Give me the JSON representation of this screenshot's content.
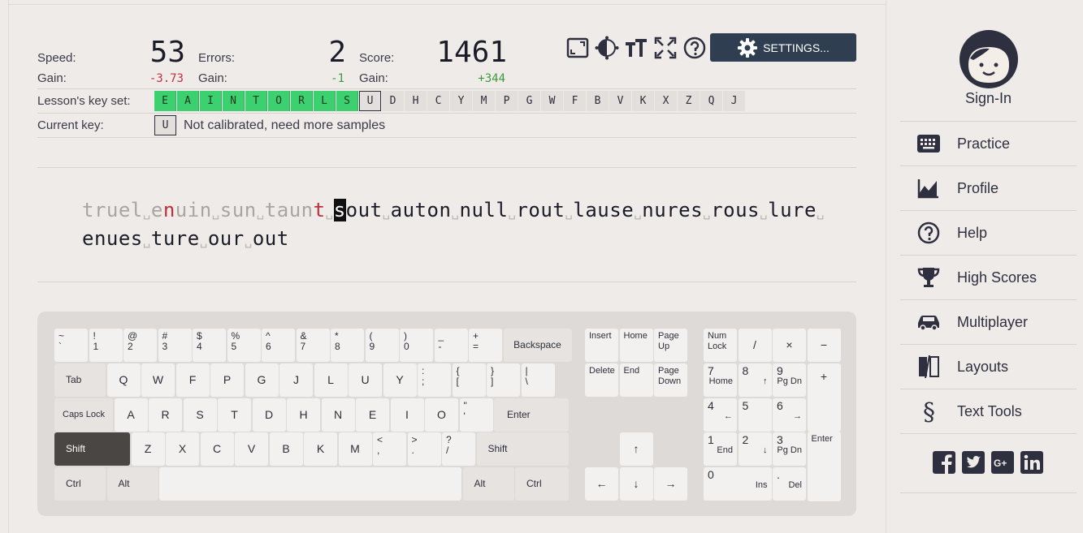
{
  "stats": {
    "speed_label": "Speed:",
    "speed_value": "53",
    "speed_gain_label": "Gain:",
    "speed_gain": "-3.73",
    "errors_label": "Errors:",
    "errors_value": "2",
    "errors_gain_label": "Gain:",
    "errors_gain": "-1",
    "score_label": "Score:",
    "score_value": "1461",
    "score_gain_label": "Gain:",
    "score_gain": "+344"
  },
  "toolbar": {
    "settings_label": "SETTINGS...",
    "icons": [
      "window-size-icon",
      "theme-icon",
      "font-size-icon",
      "fullscreen-icon",
      "help-icon"
    ]
  },
  "lesson": {
    "keyset_label": "Lesson's key set:",
    "keys_done": [
      "E",
      "A",
      "I",
      "N",
      "T",
      "O",
      "R",
      "L",
      "S"
    ],
    "key_current": "U",
    "keys_todo": [
      "D",
      "H",
      "C",
      "Y",
      "M",
      "P",
      "G",
      "W",
      "F",
      "B",
      "V",
      "K",
      "X",
      "Z",
      "Q",
      "J"
    ],
    "current_key_label": "Current key:",
    "current_key": "U",
    "current_key_status": "Not calibrated, need more samples"
  },
  "text": {
    "typed_1": "truel",
    "typed_2": "e",
    "typed_err1": "n",
    "typed_3": "uin",
    "typed_4": "sun",
    "typed_5": "taun",
    "typed_err2": "t",
    "cursor_char": "s",
    "rest_1": "out",
    "line1_words": [
      "auton",
      "null",
      "rout",
      "lause",
      "nures",
      "rous",
      "lure"
    ],
    "line2_words": [
      "enues",
      "ture",
      "our",
      "out"
    ]
  },
  "keyboard": {
    "row1": [
      [
        "~",
        "`"
      ],
      [
        "!",
        "1"
      ],
      [
        "@",
        "2"
      ],
      [
        "#",
        "3"
      ],
      [
        "$",
        "4"
      ],
      [
        "%",
        "5"
      ],
      [
        "^",
        "6"
      ],
      [
        "&",
        "7"
      ],
      [
        "*",
        "8"
      ],
      [
        "(",
        "9"
      ],
      [
        ")",
        "0"
      ],
      [
        "_",
        "-"
      ],
      [
        "+",
        "="
      ]
    ],
    "backspace": "Backspace",
    "tab": "Tab",
    "row2": [
      "Q",
      "W",
      "F",
      "P",
      "G",
      "J",
      "L",
      "U",
      "Y"
    ],
    "row2_sym": [
      [
        ":",
        ";"
      ],
      [
        "{",
        "["
      ],
      [
        "}",
        "]"
      ],
      [
        "|",
        "\\"
      ]
    ],
    "caps": "Caps Lock",
    "row3": [
      "A",
      "R",
      "S",
      "T",
      "D",
      "H",
      "N",
      "E",
      "I",
      "O"
    ],
    "row3_sym": [
      [
        "\"",
        "'"
      ]
    ],
    "enter": "Enter",
    "shift": "Shift",
    "row4": [
      "Z",
      "X",
      "C",
      "V",
      "B",
      "K",
      "M"
    ],
    "row4_sym": [
      [
        "<",
        ","
      ],
      [
        ">",
        "."
      ],
      [
        "?",
        "/"
      ]
    ],
    "ctrl": "Ctrl",
    "alt": "Alt",
    "nav_keys": [
      "Insert",
      "Home",
      "Page Up",
      "Delete",
      "End",
      "Page Down"
    ],
    "arrows": [
      "↑",
      "←",
      "↓",
      "→"
    ],
    "numpad": {
      "numlock": "Num Lock",
      "div": "/",
      "mul": "×",
      "minus": "−",
      "plus": "+",
      "enter": "Enter",
      "n7": [
        "7",
        "Home"
      ],
      "n8": [
        "8",
        "↑"
      ],
      "n9": [
        "9",
        "Pg Dn"
      ],
      "n4": [
        "4",
        "←"
      ],
      "n5": [
        "5",
        ""
      ],
      "n6": [
        "6",
        "→"
      ],
      "n1": [
        "1",
        "End"
      ],
      "n2": [
        "2",
        "↓"
      ],
      "n3": [
        "3",
        "Pg Dn"
      ],
      "n0": [
        "0",
        "Ins"
      ],
      "ndot": [
        ".",
        "Del"
      ]
    }
  },
  "sidebar": {
    "signin": "Sign-In",
    "items": [
      {
        "label": "Practice",
        "icon": "keyboard-icon"
      },
      {
        "label": "Profile",
        "icon": "chart-icon"
      },
      {
        "label": "Help",
        "icon": "help-icon"
      },
      {
        "label": "High Scores",
        "icon": "trophy-icon"
      },
      {
        "label": "Multiplayer",
        "icon": "car-icon"
      },
      {
        "label": "Layouts",
        "icon": "layouts-icon"
      },
      {
        "label": "Text Tools",
        "icon": "section-icon"
      }
    ],
    "social": [
      "facebook-icon",
      "twitter-icon",
      "google-plus-icon",
      "linkedin-icon"
    ]
  },
  "colors": {
    "key_done": "#3dd070",
    "error": "#c0303a",
    "gain_positive": "#3c9a3c",
    "settings_bg": "#2f3e50"
  }
}
